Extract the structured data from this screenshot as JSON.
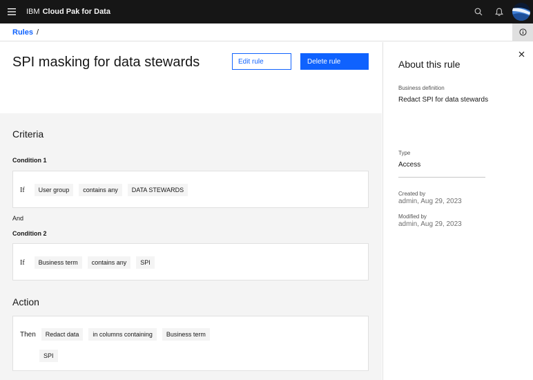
{
  "header": {
    "brand_ibm": "IBM",
    "brand_product": "Cloud Pak for Data"
  },
  "breadcrumb": {
    "root": "Rules",
    "separator": "/"
  },
  "page": {
    "title": "SPI masking for data stewards",
    "edit_label": "Edit rule",
    "delete_label": "Delete rule"
  },
  "criteria": {
    "title": "Criteria",
    "condition1": {
      "label": "Condition 1",
      "if": "If",
      "field": "User group",
      "operator": "contains any",
      "value": "DATA STEWARDS"
    },
    "and_label": "And",
    "condition2": {
      "label": "Condition 2",
      "if": "If",
      "field": "Business term",
      "operator": "contains any",
      "value": "SPI"
    }
  },
  "action": {
    "title": "Action",
    "then": "Then",
    "verb": "Redact data",
    "target": "in columns containing",
    "field": "Business term",
    "value": "SPI"
  },
  "side_panel": {
    "title": "About this rule",
    "business_definition_label": "Business definition",
    "business_definition": "Redact SPI for data stewards",
    "type_label": "Type",
    "type_value": "Access",
    "created_label": "Created by",
    "created_value": "admin, Aug 29, 2023",
    "modified_label": "Modified by",
    "modified_value": "admin, Aug 29, 2023"
  },
  "icons": {
    "menu": "hamburger-menu-icon",
    "search": "search-icon",
    "notifications": "bell-icon",
    "info": "info-icon",
    "close": "close-icon"
  },
  "colors": {
    "primary": "#0f62fe",
    "header_bg": "#161616",
    "surface": "#f4f4f4"
  }
}
